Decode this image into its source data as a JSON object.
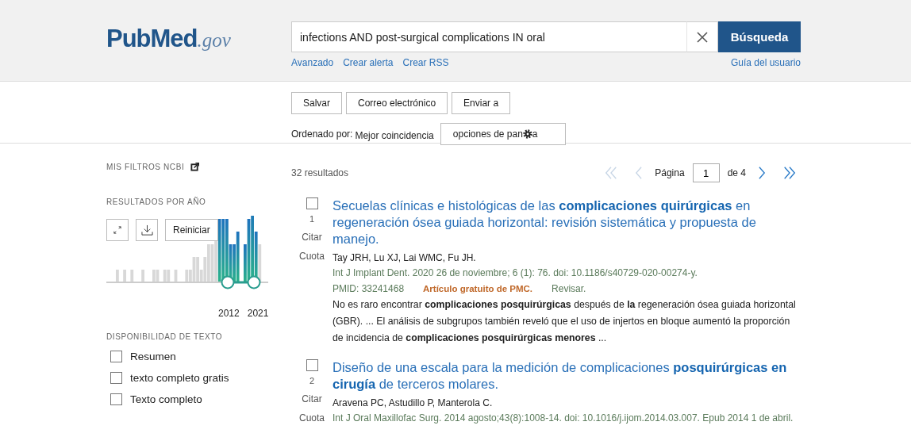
{
  "header": {
    "logo": {
      "main": "PubMed",
      ".gov": ".gov"
    },
    "search": {
      "value": "infections AND post-surgical complications IN oral"
    },
    "search_button": "Búsqueda",
    "links": [
      "Avanzado",
      "Crear alerta",
      "Crear RSS"
    ],
    "guide_link": "Guía del usuario"
  },
  "actions": [
    "Salvar",
    "Correo electrónico",
    "Enviar a"
  ],
  "sort": {
    "label": "Ordenado por:",
    "value": "Mejor coincidencia",
    "display_options": "opciones de pan",
    "display_options_tail": "a"
  },
  "sidebar": {
    "my_filters": "MIS FILTROS NCBI",
    "by_year": {
      "title": "RESULTADOS POR AÑO",
      "reset": "Reiniciar",
      "start_year": "2012",
      "end_year": "2021"
    },
    "text_availability": {
      "title": "DISPONIBILIDAD DE TEXTO",
      "items": [
        {
          "label": "Resumen",
          "checked": false
        },
        {
          "label": "texto completo gratis",
          "checked": false
        },
        {
          "label": "Texto completo",
          "checked": false
        }
      ]
    }
  },
  "results_count": "32 resultados",
  "pagination": {
    "label": "Página",
    "page": "1",
    "of": "de 4"
  },
  "results": [
    {
      "number": "1",
      "checked": false,
      "cite": "Citar",
      "share": "Cuota",
      "title": "Secuelas clínicas e histológicas de las **complicaciones quirúrgicas** en regeneración ósea guiada horizontal: revisión sistemática y propuesta de manejo.",
      "authors": "Tay JRH, Lu XJ, Lai WMC, Fu JH.",
      "citation": "Int J Implant Dent. 2020 26 de noviembre; 6 (1): 76. doi: 10.1186/s40729-020-00274-y.",
      "pmid": "PMID: 33241468",
      "free": "Artículo gratuito de PMC.",
      "type": "Revisar.",
      "snippet": "No es raro encontrar **complicaciones posquirúrgicas** después de **la** regeneración ósea guiada horizontal (GBR). ... El análisis de subgrupos también reveló que el uso de injertos en bloque aumentó la proporción de incidencia de **complicaciones posquirúrgicas menores** ..."
    },
    {
      "number": "2",
      "checked": false,
      "cite": "Citar",
      "share": "Cuota",
      "title": "Diseño de una escala para la medición de complicaciones **posquirúrgicas en cirugía** de terceros molares.",
      "authors": "Aravena PC, Astudillo P, Manterola C.",
      "citation": "Int J Oral Maxillofac Surg. 2014 agosto;43(8):1008-14. doi: 10.1016/j.ijom.2014.03.007. Epub 2014 1 de abril."
    }
  ]
}
